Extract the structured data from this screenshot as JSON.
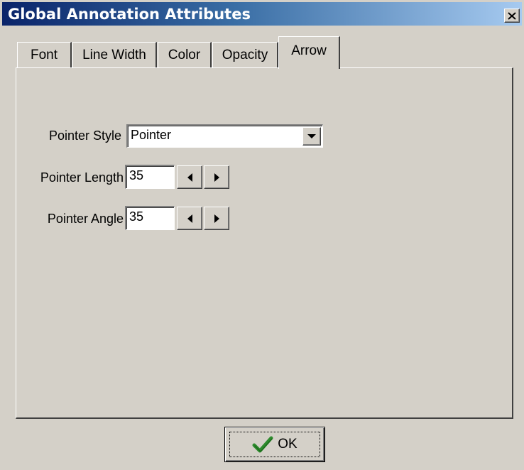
{
  "window": {
    "title": "Global Annotation Attributes",
    "close_glyph": "✕",
    "close_icon": "close-icon"
  },
  "tabs": [
    {
      "label": "Font",
      "active": false
    },
    {
      "label": "Line Width",
      "active": false
    },
    {
      "label": "Color",
      "active": false
    },
    {
      "label": "Opacity",
      "active": false
    },
    {
      "label": "Arrow",
      "active": true
    }
  ],
  "arrow": {
    "pointer_style": {
      "label": "Pointer Style",
      "value": "Pointer",
      "dropdown_icon": "chevron-down-icon"
    },
    "pointer_length": {
      "label": "Pointer Length",
      "value": "35"
    },
    "pointer_angle": {
      "label": "Pointer Angle",
      "value": "35"
    },
    "decrement_icon": "arrow-left-icon",
    "increment_icon": "arrow-right-icon"
  },
  "ok_button": {
    "label": "OK",
    "icon": "checkmark-icon",
    "icon_color": "#2e8b2e"
  },
  "colors": {
    "face": "#d4d0c8",
    "title_start": "#0a246a",
    "title_end": "#a6caf0"
  }
}
